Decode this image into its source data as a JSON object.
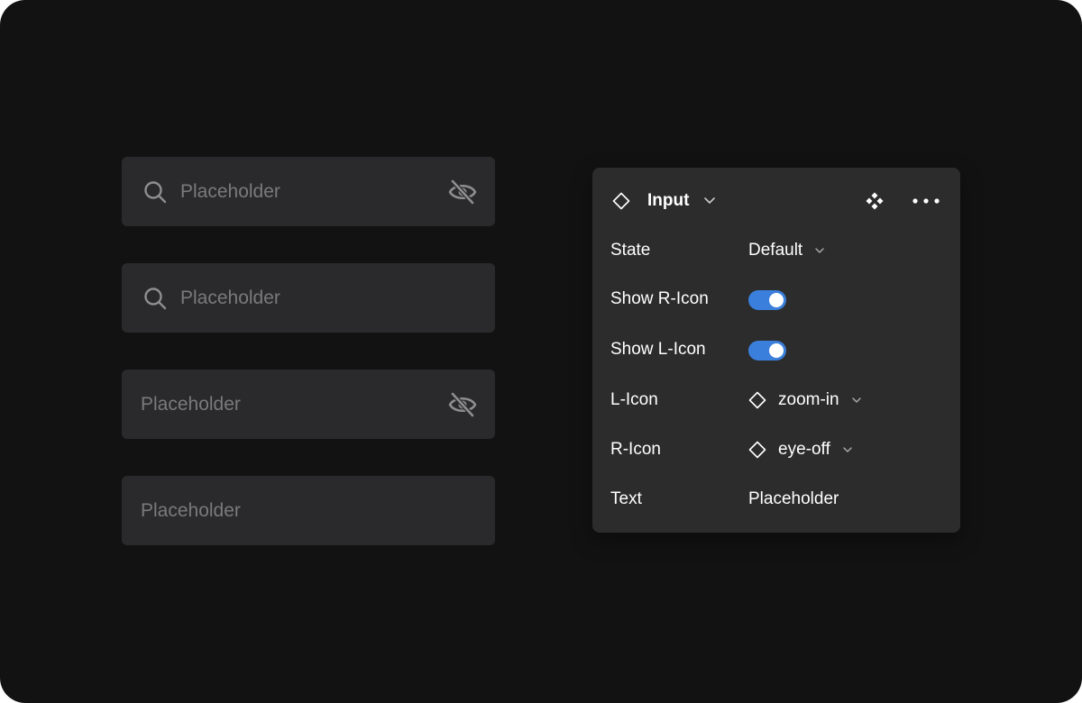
{
  "inputs": [
    {
      "placeholder": "Placeholder",
      "l_icon": "search-icon",
      "r_icon": "eye-off-icon"
    },
    {
      "placeholder": "Placeholder",
      "l_icon": "search-icon",
      "r_icon": ""
    },
    {
      "placeholder": "Placeholder",
      "l_icon": "",
      "r_icon": "eye-off-icon"
    },
    {
      "placeholder": "Placeholder",
      "l_icon": "",
      "r_icon": ""
    }
  ],
  "panel": {
    "title": "Input",
    "header_icons": [
      "component-diamond-icon",
      "chevron-down-icon",
      "component-variant-icon",
      "more-horizontal-icon"
    ],
    "properties": [
      {
        "label": "State",
        "value": "Default",
        "type": "dropdown"
      },
      {
        "label": "Show R-Icon",
        "value": true,
        "type": "toggle"
      },
      {
        "label": "Show L-Icon",
        "value": true,
        "type": "toggle"
      },
      {
        "label": "L-Icon",
        "value": "zoom-in",
        "type": "instance"
      },
      {
        "label": "R-Icon",
        "value": "eye-off",
        "type": "instance"
      },
      {
        "label": "Text",
        "value": "Placeholder",
        "type": "text"
      }
    ]
  },
  "colors": {
    "background": "#121212",
    "field": "#2a2a2c",
    "panel": "#2c2c2c",
    "toggle_on": "#3a7fdb",
    "placeholder": "#7a7a7c",
    "icon": "#8e8e90"
  }
}
